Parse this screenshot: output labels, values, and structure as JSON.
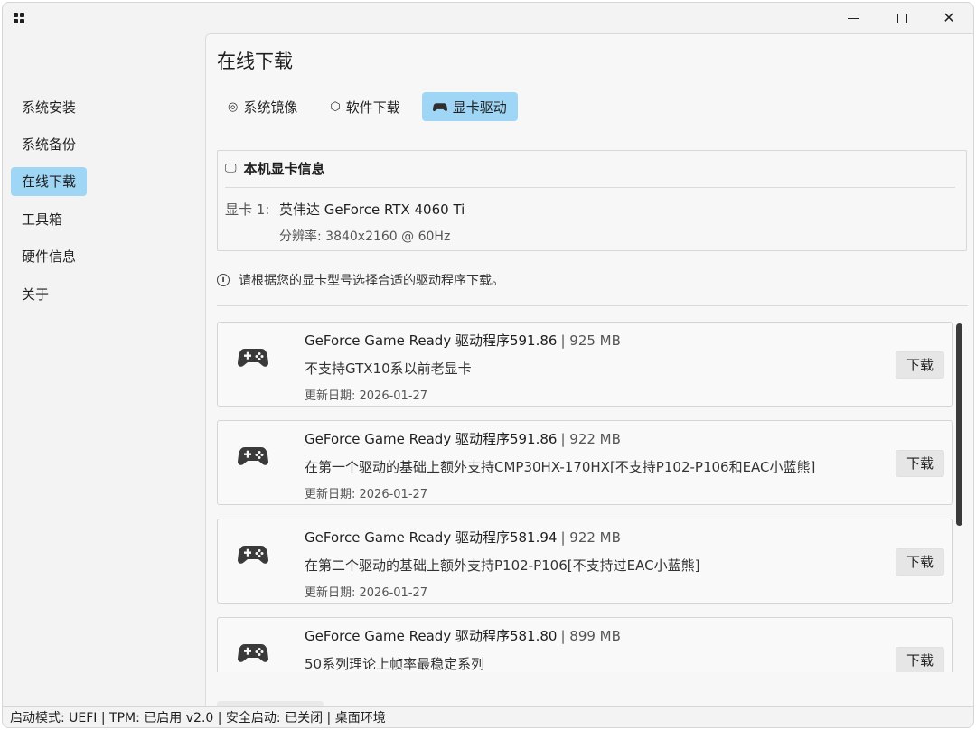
{
  "window": {
    "controls": {
      "minimize": "minimize-icon",
      "maximize": "maximize-icon",
      "close": "close-icon"
    }
  },
  "sidebar": {
    "items": [
      {
        "label": "系统安装",
        "active": false
      },
      {
        "label": "系统备份",
        "active": false
      },
      {
        "label": "在线下载",
        "active": true
      },
      {
        "label": "工具箱",
        "active": false
      },
      {
        "label": "硬件信息",
        "active": false
      },
      {
        "label": "关于",
        "active": false
      }
    ]
  },
  "main": {
    "title": "在线下载",
    "tabs": [
      {
        "icon": "disc-icon",
        "label": "系统镜像",
        "active": false
      },
      {
        "icon": "box-icon",
        "label": "软件下载",
        "active": false
      },
      {
        "icon": "gamepad-icon",
        "label": "显卡驱动",
        "active": true
      }
    ],
    "gpu_info": {
      "heading": "本机显卡信息",
      "label": "显卡 1:",
      "name": "英伟达 GeForce RTX 4060 Ti",
      "resolution": "分辨率: 3840x2160 @ 60Hz"
    },
    "hint": "请根据您的显卡型号选择合适的驱动程序下载。",
    "drivers": [
      {
        "title": "GeForce Game Ready 驱动程序591.86",
        "size": "| 925 MB",
        "desc": "不支持GTX10系以前老显卡",
        "date": "更新日期: 2026-01-27",
        "button": "下载"
      },
      {
        "title": "GeForce Game Ready 驱动程序591.86",
        "size": "| 922  MB",
        "desc": "在第一个驱动的基础上额外支持CMP30HX-170HX[不支持P102-P106和EAC小蓝熊]",
        "date": "更新日期: 2026-01-27",
        "button": "下载"
      },
      {
        "title": "GeForce Game Ready 驱动程序581.94",
        "size": "| 922  MB",
        "desc": "在第二个驱动的基础上额外支持P102-P106[不支持过EAC小蓝熊]",
        "date": "更新日期: 2026-01-27",
        "button": "下载"
      },
      {
        "title": "GeForce Game Ready 驱动程序581.80",
        "size": "| 899 MB",
        "desc": "50系列理论上帧率最稳定系列",
        "date": "",
        "button": "下载"
      }
    ]
  },
  "status": {
    "text": "启动模式: UEFI | TPM: 已启用 v2.0 | 安全启动: 已关闭 | 桌面环境"
  },
  "colors": {
    "accent": "#9fd6f5",
    "background": "#f3f3f3",
    "scroll_thumb": "#3a3a3a"
  }
}
